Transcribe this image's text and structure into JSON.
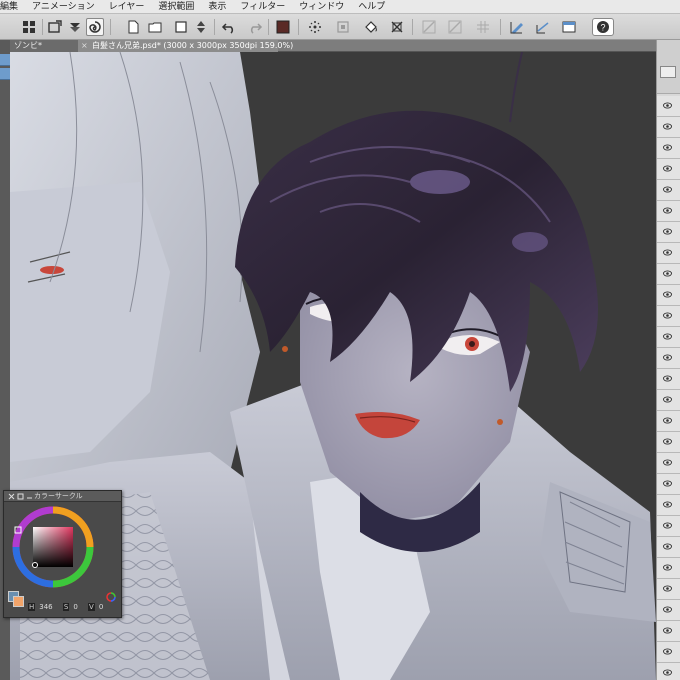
{
  "menubar": {
    "items": [
      "編集",
      "アニメーション",
      "レイヤー",
      "選択範囲",
      "表示",
      "フィルター",
      "ウィンドウ",
      "ヘルプ"
    ]
  },
  "toolbar": {
    "icons": [
      "grid-icon",
      "import-icon",
      "swirl-icon",
      "file-icon",
      "open-folder-icon",
      "new-canvas-icon",
      "undo-icon",
      "redo-icon",
      "color-swatch-icon",
      "sparkle-icon",
      "transform-icon",
      "fill-icon",
      "crop-icon",
      "ruler-icon",
      "pen-icon",
      "window-icon",
      "help-icon"
    ],
    "swatch_color": "#5a2a26"
  },
  "tabs": {
    "inactive_label": "ゾンビ*",
    "active_label": "白髪さん兄弟.psd* (3000 x 3000px 350dpi 159.0%)"
  },
  "color_panel": {
    "title": "カラーサークル",
    "main_color": "#6a8fb0",
    "sub_color": "#f2a46a",
    "hue_label": "H",
    "hue_value": "346",
    "sat_label": "S",
    "sat_value": "0",
    "val_label": "V",
    "val_value": "0"
  },
  "colors": {
    "accent": "#5b8fc9",
    "canvas_bg": "#3b3b3b",
    "lips": "#c4453b",
    "eye": "#c8463a"
  }
}
